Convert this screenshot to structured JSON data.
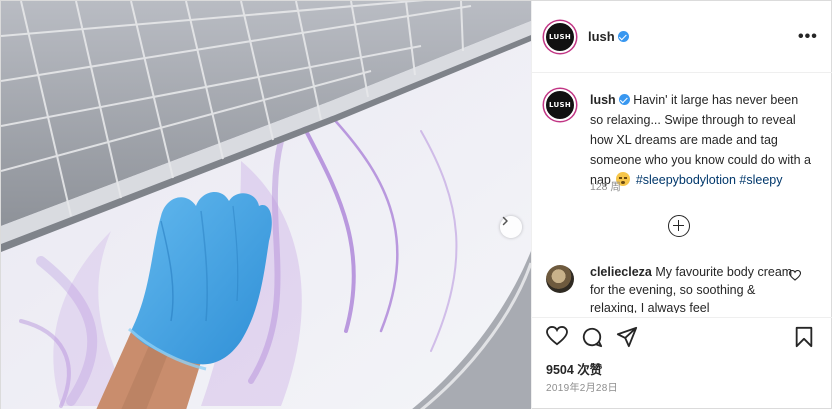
{
  "post": {
    "author": "lush",
    "avatar_text": "LUSH",
    "more_label": "•••",
    "caption": {
      "username": "lush",
      "text": "Havin' it large has never been so relaxing... Swipe through to reveal how XL dreams are made and tag someone who you know could do with a nap",
      "hashtags": [
        "#sleepybodylotion",
        "#sleepy"
      ],
      "time_ago": "128 周"
    },
    "comment": {
      "username": "cleliecleza",
      "text": "My favourite body cream for the evening, so soothing & relaxing, I always feel"
    },
    "likes": "9504 次赞",
    "date": "2019年2月28日"
  },
  "icons": {
    "verified": "verified-badge-icon",
    "like": "heart-icon",
    "comment": "comment-bubble-icon",
    "share": "paper-plane-icon",
    "save": "bookmark-icon",
    "load_more": "plus-circle-icon",
    "next": "chevron-right-icon",
    "emoji": "sleeping-face-emoji"
  },
  "colors": {
    "verified": "#3897f0",
    "hashtag": "#00376b",
    "muted": "#8e8e8e",
    "avatar_ring": "#c13584"
  }
}
